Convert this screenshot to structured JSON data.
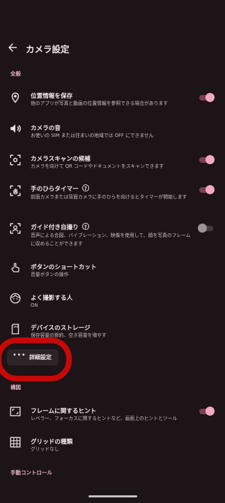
{
  "header": {
    "title": "カメラ設定"
  },
  "sections": {
    "general": "全般",
    "composition": "構図",
    "manual": "手動コントロール"
  },
  "rows": [
    {
      "title": "位置情報を保存",
      "subtitle": "他のアプリが写真と動画の位置情報を参照できる場合があります",
      "icon": "location-pin-icon",
      "toggle": "on"
    },
    {
      "title": "カメラの音",
      "subtitle": "お使いの SIM または住まいの地域では OFF にできません",
      "icon": "speaker-icon",
      "toggle": "none"
    },
    {
      "title": "カメラスキャンの候補",
      "subtitle": "カメラを向けて QR コードやドキュメントをスキャンできます",
      "icon": "scan-icon",
      "toggle": "on"
    },
    {
      "title": "手のひらタイマー",
      "subtitle": "前面カメラまたは背面カメラに手のひらを向けるとタイマーが開始します",
      "icon": "palm-timer-icon",
      "toggle": "on"
    },
    {
      "title": "ガイド付き自撮り",
      "subtitle": "音声による合図、バイブレーション、映像を使用して、顔を写真のフレームに収めることができます",
      "icon": "guided-selfie-icon",
      "toggle": "off"
    },
    {
      "title": "ボタンのショートカット",
      "subtitle": "音量ボタンの操作",
      "icon": "hand-tap-icon",
      "toggle": "none"
    },
    {
      "title": "よく撮影する人",
      "subtitle": "ON",
      "icon": "face-icon",
      "toggle": "none"
    },
    {
      "title": "デバイスのストレージ",
      "subtitle": "保存容量の節約、空き容量を増やす",
      "icon": "storage-icon",
      "toggle": "none"
    },
    {
      "title": "フレームに関するヒント",
      "subtitle": "レベラー、フォーカスに関するヒントなど、画面上のヒントとツール",
      "icon": "frame-hint-icon",
      "toggle": "on"
    },
    {
      "title": "グリッドの種類",
      "subtitle": "グリッドなし",
      "icon": "grid-icon",
      "toggle": "none"
    }
  ],
  "advanced": {
    "label": "詳細設定",
    "dots": "•••"
  },
  "help_glyph": "?",
  "colors": {
    "accent": "#f4a9c3",
    "section": "#e8b3c0",
    "background": "#1c1416",
    "highlight": "#c60808"
  }
}
